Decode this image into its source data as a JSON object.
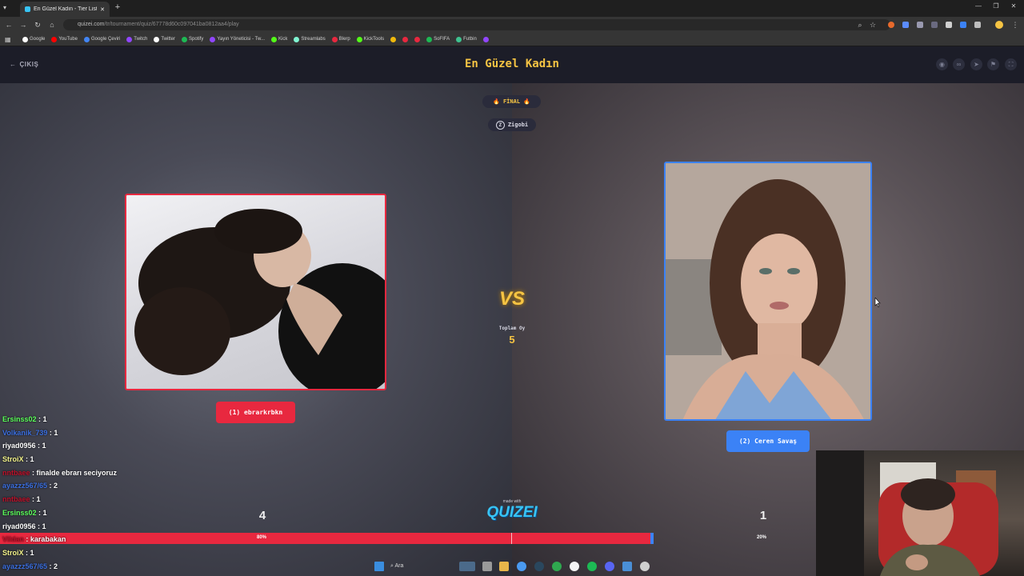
{
  "browser": {
    "tab_title": "En Güzel Kadın - Tier List, Kör S",
    "url_host": "quizei.com",
    "url_path": "/tr/tournament/quiz/67778d60c097041ba0812aa4/play",
    "bookmarks": [
      {
        "label": "Google",
        "color": "#ffffff"
      },
      {
        "label": "YouTube",
        "color": "#ff0000"
      },
      {
        "label": "Google Çeviri",
        "color": "#4285f4"
      },
      {
        "label": "Twitch",
        "color": "#9146ff"
      },
      {
        "label": "Twitter",
        "color": "#ffffff"
      },
      {
        "label": "Spotify",
        "color": "#1db954"
      },
      {
        "label": "Yayın Yöneticisi - Tw...",
        "color": "#9146ff"
      },
      {
        "label": "Kick",
        "color": "#53fc18"
      },
      {
        "label": "Streamlabs",
        "color": "#80f5d2"
      },
      {
        "label": "Blerp",
        "color": "#e8283f"
      },
      {
        "label": "KickTools",
        "color": "#53fc18"
      },
      {
        "label": "",
        "color": "#f0b90b"
      },
      {
        "label": "",
        "color": "#e8283f"
      },
      {
        "label": "",
        "color": "#e8283f"
      },
      {
        "label": "SoFIFA",
        "color": "#1db954"
      },
      {
        "label": "Futbin",
        "color": "#3ec28f"
      },
      {
        "label": "",
        "color": "#9146ff"
      }
    ]
  },
  "header": {
    "back_label": "ÇIKIŞ",
    "title": "En Güzel Kadın"
  },
  "round": {
    "badge": "🔥 FİNAL 🔥",
    "user": "Zigobi",
    "user_initial": "Z"
  },
  "contestants": {
    "left": {
      "label": "(1) ebrarkrbkn",
      "votes": "4",
      "percent": "80%",
      "share": 0.8
    },
    "right": {
      "label": "(2) Ceren Savaş",
      "votes": "1",
      "percent": "20%",
      "share": 0.2
    }
  },
  "center": {
    "vs": "VS",
    "total_label": "Toplam Oy",
    "total_value": "5",
    "made_with": "made with",
    "brand": "QUIZEI"
  },
  "chat": [
    {
      "user": "Ersinss02",
      "text": " : 1",
      "color": "#5cff5c"
    },
    {
      "user": "Volkanik_739",
      "text": " : 1",
      "color": "#3b6fe0"
    },
    {
      "user": "riyad0956",
      "text": " : 1",
      "color": "#ffffff"
    },
    {
      "user": "StroiX",
      "text": " : 1",
      "color": "#f2f28a"
    },
    {
      "user": "nntbaee",
      "text": " : finalde ebrarı seciyoruz",
      "color": "#c0102a"
    },
    {
      "user": "ayazzz567/65",
      "text": " : 2",
      "color": "#3b6fe0"
    },
    {
      "user": "nntbaee",
      "text": " : 1",
      "color": "#c0102a"
    },
    {
      "user": "Ersinss02",
      "text": " : 1",
      "color": "#5cff5c"
    },
    {
      "user": "riyad0956",
      "text": " : 1",
      "color": "#ffffff"
    },
    {
      "user": "Vildan",
      "text": " : karabakan",
      "color": "#c0102a"
    },
    {
      "user": "StroiX",
      "text": " : 1",
      "color": "#f2f28a"
    },
    {
      "user": "ayazzz567/65",
      "text": " : 2",
      "color": "#3b6fe0"
    }
  ],
  "taskbar": {
    "search": "Ara"
  },
  "colors": {
    "accent": "#f6c443",
    "left": "#e8283f",
    "right": "#3b82f6"
  }
}
